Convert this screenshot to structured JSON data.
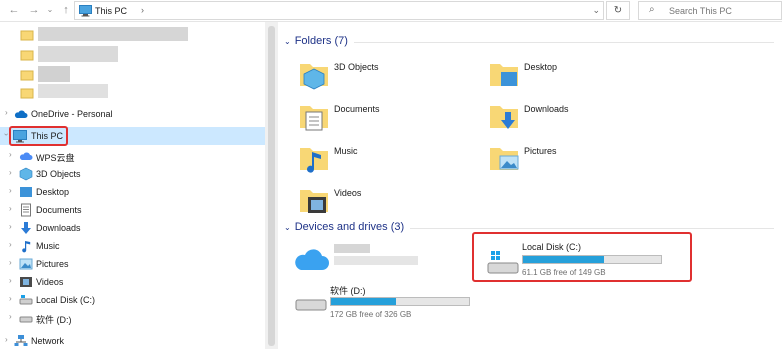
{
  "address_bar": {
    "path": "This PC",
    "search_placeholder": "Search This PC"
  },
  "nav_pane": {
    "items": [
      {
        "label": "OneDrive - Personal",
        "icon": "cloud-icon"
      },
      {
        "label": "This PC",
        "icon": "computer-icon",
        "selected": true
      },
      {
        "label": "WPS云盘",
        "icon": "wps-cloud-icon"
      },
      {
        "label": "3D Objects",
        "icon": "3d-objects-icon"
      },
      {
        "label": "Desktop",
        "icon": "desktop-folder-icon"
      },
      {
        "label": "Documents",
        "icon": "documents-icon"
      },
      {
        "label": "Downloads",
        "icon": "downloads-icon"
      },
      {
        "label": "Music",
        "icon": "music-icon"
      },
      {
        "label": "Pictures",
        "icon": "pictures-icon"
      },
      {
        "label": "Videos",
        "icon": "videos-icon"
      },
      {
        "label": "Local Disk (C:)",
        "icon": "drive-icon"
      },
      {
        "label": "软件 (D:)",
        "icon": "drive-icon"
      },
      {
        "label": "Network",
        "icon": "network-icon"
      }
    ]
  },
  "content": {
    "folders_header": "Folders (7)",
    "folders": [
      {
        "label": "3D Objects",
        "icon": "3d-objects-folder-icon"
      },
      {
        "label": "Desktop",
        "icon": "desktop-folder-icon"
      },
      {
        "label": "Documents",
        "icon": "documents-folder-icon"
      },
      {
        "label": "Downloads",
        "icon": "downloads-folder-icon"
      },
      {
        "label": "Music",
        "icon": "music-folder-icon"
      },
      {
        "label": "Pictures",
        "icon": "pictures-folder-icon"
      },
      {
        "label": "Videos",
        "icon": "videos-folder-icon"
      }
    ],
    "devices_header": "Devices and drives (3)",
    "drives": [
      {
        "name": "Local Disk (C:)",
        "free": "61.1 GB free of 149 GB",
        "used_fraction": 0.59,
        "highlighted": true
      },
      {
        "name": "软件 (D:)",
        "free": "172 GB free of 326 GB",
        "used_fraction": 0.47
      }
    ]
  },
  "colors": {
    "accent_header": "#1e3287",
    "selection": "#cce8ff",
    "bar_fill": "#26a0da",
    "highlight_box": "#e03030",
    "folder_yellow": "#f8d775"
  }
}
